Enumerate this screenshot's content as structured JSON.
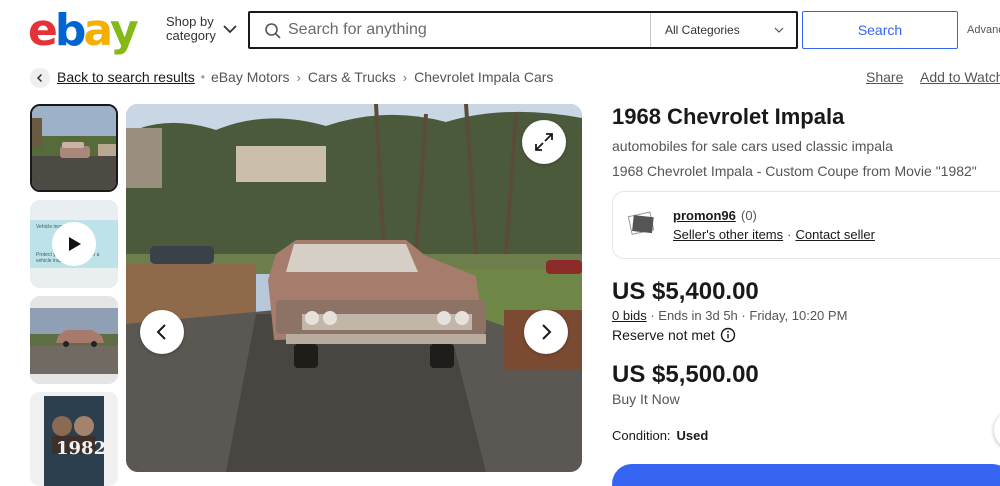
{
  "header": {
    "logo_letters": [
      {
        "char": "e",
        "color": "#e53238"
      },
      {
        "char": "b",
        "color": "#0064d2"
      },
      {
        "char": "a",
        "color": "#f5af02"
      },
      {
        "char": "y",
        "color": "#86b817"
      }
    ],
    "shop_by_line1": "Shop by",
    "shop_by_line2": "category",
    "search_placeholder": "Search for anything",
    "category_selected": "All Categories",
    "search_button": "Search",
    "advanced_label": "Advanced"
  },
  "breadcrumb": {
    "back_label": "Back to search results",
    "items": [
      "eBay Motors",
      "Cars & Trucks",
      "Chevrolet Impala Cars"
    ],
    "share_label": "Share",
    "watch_label": "Add to Watchlist"
  },
  "gallery": {
    "video_thumb_text_top": "Vehicle inspection",
    "video_thumb_text_bottom": "Protect your purchase with a vehicle inspection",
    "poster_title": "1982"
  },
  "listing": {
    "title": "1968 Chevrolet Impala",
    "subtitle": "automobiles for sale cars used classic impala",
    "description": "1968 Chevrolet Impala - Custom Coupe from Movie \"1982\"",
    "seller_name": "promon96",
    "seller_feedback": "(0)",
    "seller_other_items": "Seller's other items",
    "contact_seller": "Contact seller",
    "bid_price": "US $5,400.00",
    "bids_count": "0 bids",
    "ends_text": "Ends in 3d 5h",
    "ends_time": "Friday, 10:20 PM",
    "reserve_text": "Reserve not met",
    "buy_price": "US $5,500.00",
    "buy_label": "Buy It Now",
    "condition_label": "Condition:",
    "condition_value": "Used"
  },
  "colors": {
    "accent": "#3665f3",
    "text": "#191919",
    "muted": "#555555"
  }
}
